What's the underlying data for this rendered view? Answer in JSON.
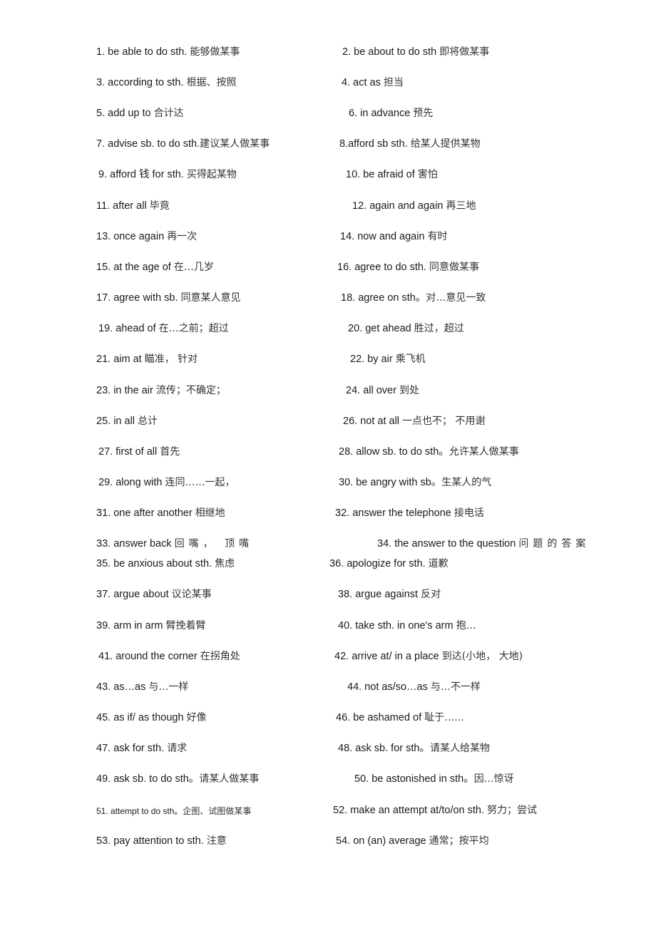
{
  "entries": [
    {
      "n": "1.",
      "en": "be able to do sth.",
      "zh": "能够做某事"
    },
    {
      "n": "2.",
      "en": "be about to do sth",
      "zh": "即将做某事"
    },
    {
      "n": "3.",
      "en": "according to sth.",
      "zh": "根据、按照"
    },
    {
      "n": "4.",
      "en": "act as",
      "zh": "担当"
    },
    {
      "n": "5.",
      "en": "add up to",
      "zh": "合计达"
    },
    {
      "n": "6.",
      "en": "in advance",
      "zh": "预先"
    },
    {
      "n": "7.",
      "en": "advise sb. to do sth.",
      "zh": "建议某人做某事"
    },
    {
      "n": "8.",
      "en": "afford sb sth.",
      "zh": "给某人提供某物"
    },
    {
      "n": "9.",
      "en": "afford 钱 for sth.",
      "zh": "买得起某物"
    },
    {
      "n": "10.",
      "en": "be afraid of",
      "zh": "害怕"
    },
    {
      "n": "11.",
      "en": "after all",
      "zh": "毕竟"
    },
    {
      "n": "12.",
      "en": "again and again",
      "zh": "再三地"
    },
    {
      "n": "13.",
      "en": "once again",
      "zh": "再一次"
    },
    {
      "n": "14.",
      "en": "now and again",
      "zh": "有时"
    },
    {
      "n": "15.",
      "en": "at the age of",
      "zh": "在…几岁"
    },
    {
      "n": "16.",
      "en": "agree to do sth.",
      "zh": "同意做某事"
    },
    {
      "n": "17.",
      "en": "agree with sb.",
      "zh": "同意某人意见"
    },
    {
      "n": "18.",
      "en": "agree on sth。",
      "zh": "对…意见一致"
    },
    {
      "n": "19.",
      "en": "ahead of",
      "zh": "在…之前；超过"
    },
    {
      "n": "20.",
      "en": "get ahead",
      "zh": "胜过，超过"
    },
    {
      "n": "21.",
      "en": "aim at",
      "zh": " 瞄准， 针对"
    },
    {
      "n": "22.",
      "en": "by air",
      "zh": "乘飞机"
    },
    {
      "n": "23.",
      "en": "in the air",
      "zh": "流传；不确定；"
    },
    {
      "n": "24.",
      "en": "all over",
      "zh": "到处"
    },
    {
      "n": "25.",
      "en": "in all",
      "zh": "总计"
    },
    {
      "n": "26.",
      "en": "not at all",
      "zh": "一点也不； 不用谢"
    },
    {
      "n": "27.",
      "en": "first of all",
      "zh": "首先"
    },
    {
      "n": "28.",
      "en": "allow sb. to do sth。",
      "zh": "允许某人做某事"
    },
    {
      "n": "29.",
      "en": "along with",
      "zh": "连同……一起，"
    },
    {
      "n": "30.",
      "en": "be angry with sb。",
      "zh": "生某人的气"
    },
    {
      "n": "31.",
      "en": "one after another",
      "zh": "相继地"
    },
    {
      "n": "32.",
      "en": "answer the telephone",
      "zh": "接电话"
    },
    {
      "n": "33.",
      "en": "answer back",
      "zh": " 回嘴， 顶嘴"
    },
    {
      "n": "34.",
      "en": "the answer to the question",
      "zh": " 问题的答案"
    },
    {
      "n": "35.",
      "en": "be anxious about sth.",
      "zh": "焦虑"
    },
    {
      "n": "36.",
      "en": "apologize for sth.",
      "zh": "道歉"
    },
    {
      "n": "37.",
      "en": "argue about",
      "zh": "议论某事"
    },
    {
      "n": "38.",
      "en": "argue against",
      "zh": " 反对"
    },
    {
      "n": "39.",
      "en": "arm in arm",
      "zh": "臂挽着臂"
    },
    {
      "n": "40.",
      "en": "take sth. in one's arm",
      "zh": "抱…"
    },
    {
      "n": "41.",
      "en": "around the corner",
      "zh": "在拐角处"
    },
    {
      "n": "42.",
      "en": "arrive at/ in a place",
      "zh": "到达(小地， 大地)"
    },
    {
      "n": "43.",
      "en": "as…as",
      "zh": "与…一样"
    },
    {
      "n": "44.",
      "en": "not as/so…as",
      "zh": "与…不一样"
    },
    {
      "n": "45.",
      "en": "as if/ as though",
      "zh": "好像"
    },
    {
      "n": "46.",
      "en": "be ashamed of",
      "zh": "耻于……"
    },
    {
      "n": "47.",
      "en": "ask for sth.",
      "zh": "请求"
    },
    {
      "n": "48.",
      "en": "ask sb. for sth。",
      "zh": "请某人给某物"
    },
    {
      "n": "49.",
      "en": "ask sb. to do sth。",
      "zh": "请某人做某事"
    },
    {
      "n": "50.",
      "en": "be astonished in sth。",
      "zh": "因…惊讶"
    },
    {
      "n": "51.",
      "en": "attempt to do sth。",
      "zh": "企图、试图做某事"
    },
    {
      "n": "52.",
      "en": "make an attempt at/to/on sth.",
      "zh": "努力；尝试"
    },
    {
      "n": "53.",
      "en": "pay attention to sth.",
      "zh": "注意"
    },
    {
      "n": "54.",
      "en": "on (an) average",
      "zh": "通常；按平均"
    }
  ]
}
